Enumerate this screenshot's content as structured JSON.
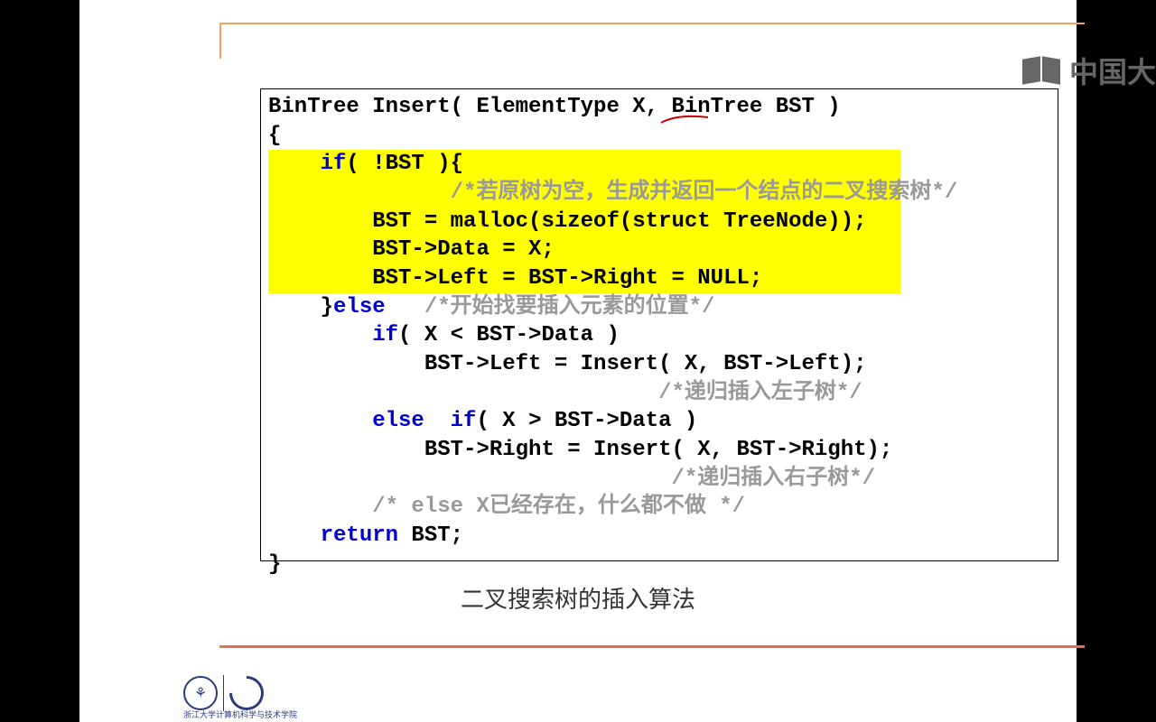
{
  "code": {
    "sig": "BinTree Insert( ElementType X, BinTree BST )",
    "open": "{",
    "if_head": "    if( !BST ){",
    "cm1": "              /*若原树为空，生成并返回一个结点的二叉搜索树*/",
    "malloc": "        BST = malloc(sizeof(struct TreeNode));",
    "data": "        BST->Data = X;",
    "nulls": "        BST->Left = BST->Right = NULL;",
    "else_open": "    }",
    "else_kw": "else",
    "cm2": "   /*开始找要插入元素的位置*/",
    "if_lt": "        if( X < BST->Data )",
    "ins_left": "            BST->Left = Insert( X, BST->Left);",
    "cm3": "                              /*递归插入左子树*/",
    "else_if_kw1": "        else",
    "else_if_cond": "  if( X > BST->Data )",
    "ins_right": "            BST->Right = Insert( X, BST->Right);",
    "cm4": "                               /*递归插入右子树*/",
    "cm5": "        /* else X已经存在，什么都不做 */",
    "ret_kw": "    return",
    "ret_val": " BST;",
    "close": "}"
  },
  "caption": "二叉搜索树的插入算法",
  "logo_text": "浙江大学计算机科学与技术学院",
  "watermark": "中国大"
}
